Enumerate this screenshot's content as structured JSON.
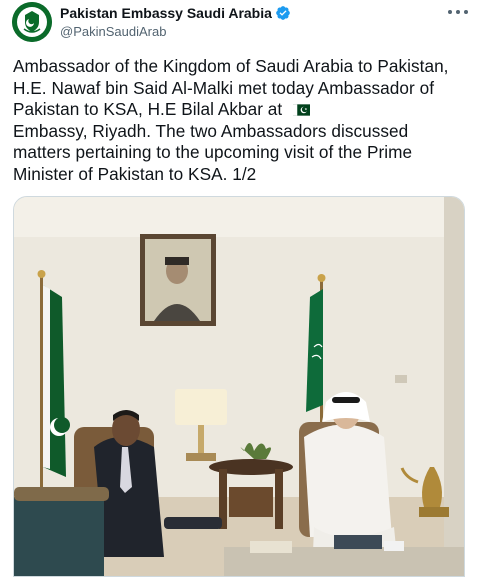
{
  "author": {
    "display_name": "Pakistan Embassy Saudi Arabia",
    "handle": "@PakinSaudiArab",
    "avatar_icon": "embassy-emblem-icon",
    "verified_icon": "verified-badge-icon",
    "verified_color": "#1d9bf0"
  },
  "menu": {
    "icon": "more-options-icon"
  },
  "tweet": {
    "text": "Ambassador of the Kingdom of Saudi Arabia to Pakistan, H.E. Nawaf bin Said Al-Malki met today Ambassador of Pakistan to KSA, H.E Bilal Akbar at ",
    "text_tail": "Embassy, Riyadh. The two Ambassadors discussed matters pertaining to the upcoming visit of the Prime Minister of Pakistan to KSA. 1/2",
    "flag_icon": "pakistan-flag-emoji-icon"
  },
  "media": {
    "kind": "photo",
    "icon": "tweet-photo-image"
  },
  "colors": {
    "text": "#0f1419",
    "secondary": "#536471",
    "border": "#cfd9de",
    "pakistan_green": "#01411c",
    "saudi_green": "#006c35"
  }
}
